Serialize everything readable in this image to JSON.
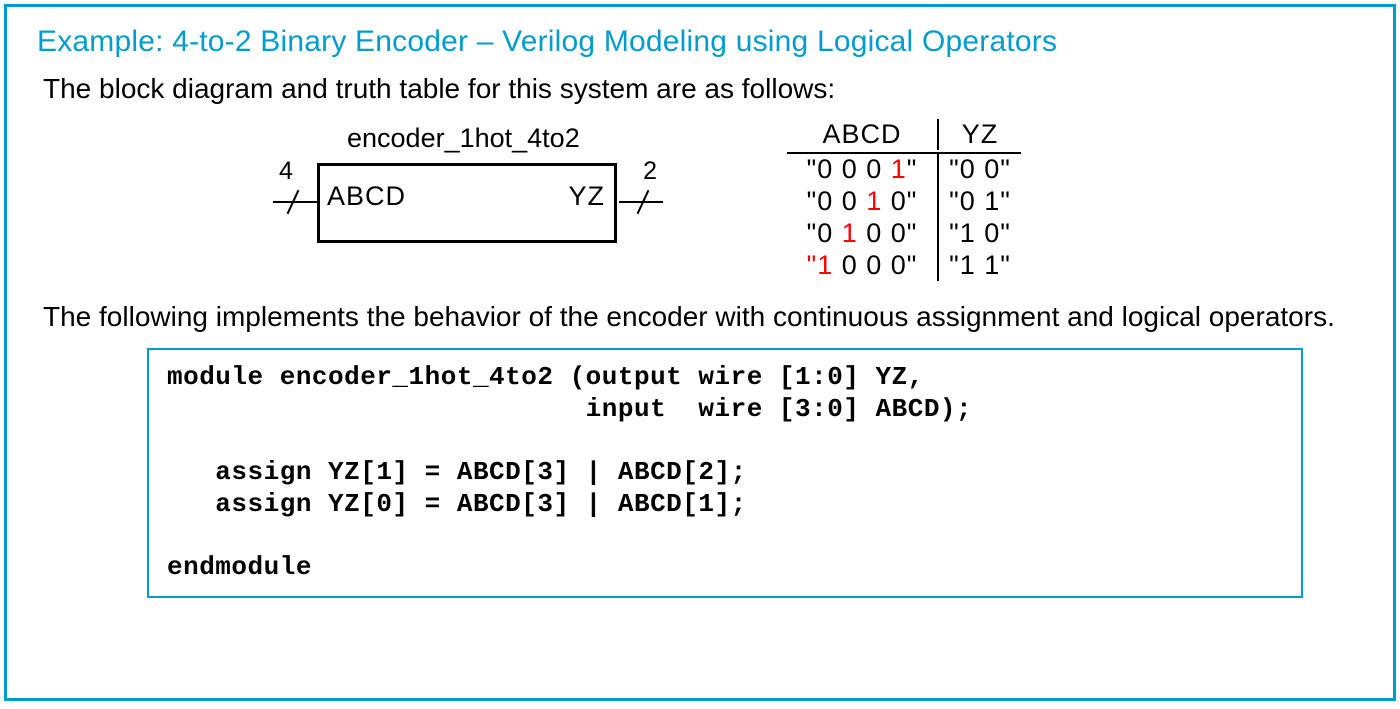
{
  "title": "Example: 4-to-2 Binary Encoder – Verilog Modeling using Logical Operators",
  "lead": "The block diagram and truth table for this system are as follows:",
  "diagram": {
    "module_label": "encoder_1hot_4to2",
    "port_left": "ABCD",
    "port_right": "YZ",
    "width_left": "4",
    "width_right": "2"
  },
  "truth": {
    "header_in": "ABCD",
    "header_out": "YZ",
    "rows": [
      {
        "in_pre": "\"0 0 0 ",
        "in_red": "1",
        "in_post": "\"",
        "out": "\"0 0\""
      },
      {
        "in_pre": "\"0 0 ",
        "in_red": "1",
        "in_post": " 0\"",
        "out": "\"0 1\""
      },
      {
        "in_pre": "\"0 ",
        "in_red": "1",
        "in_post": " 0 0\"",
        "out": "\"1 0\""
      },
      {
        "in_pre": "\"",
        "in_red": "1",
        "in_post": " 0 0 0\"",
        "out": "\"1 1\""
      }
    ]
  },
  "para2": "The following implements the behavior of the encoder with continuous assignment and logical operators.",
  "code": "module encoder_1hot_4to2 (output wire [1:0] YZ,\n                          input  wire [3:0] ABCD);\n\n   assign YZ[1] = ABCD[3] | ABCD[2];\n   assign YZ[0] = ABCD[3] | ABCD[1];\n\nendmodule"
}
